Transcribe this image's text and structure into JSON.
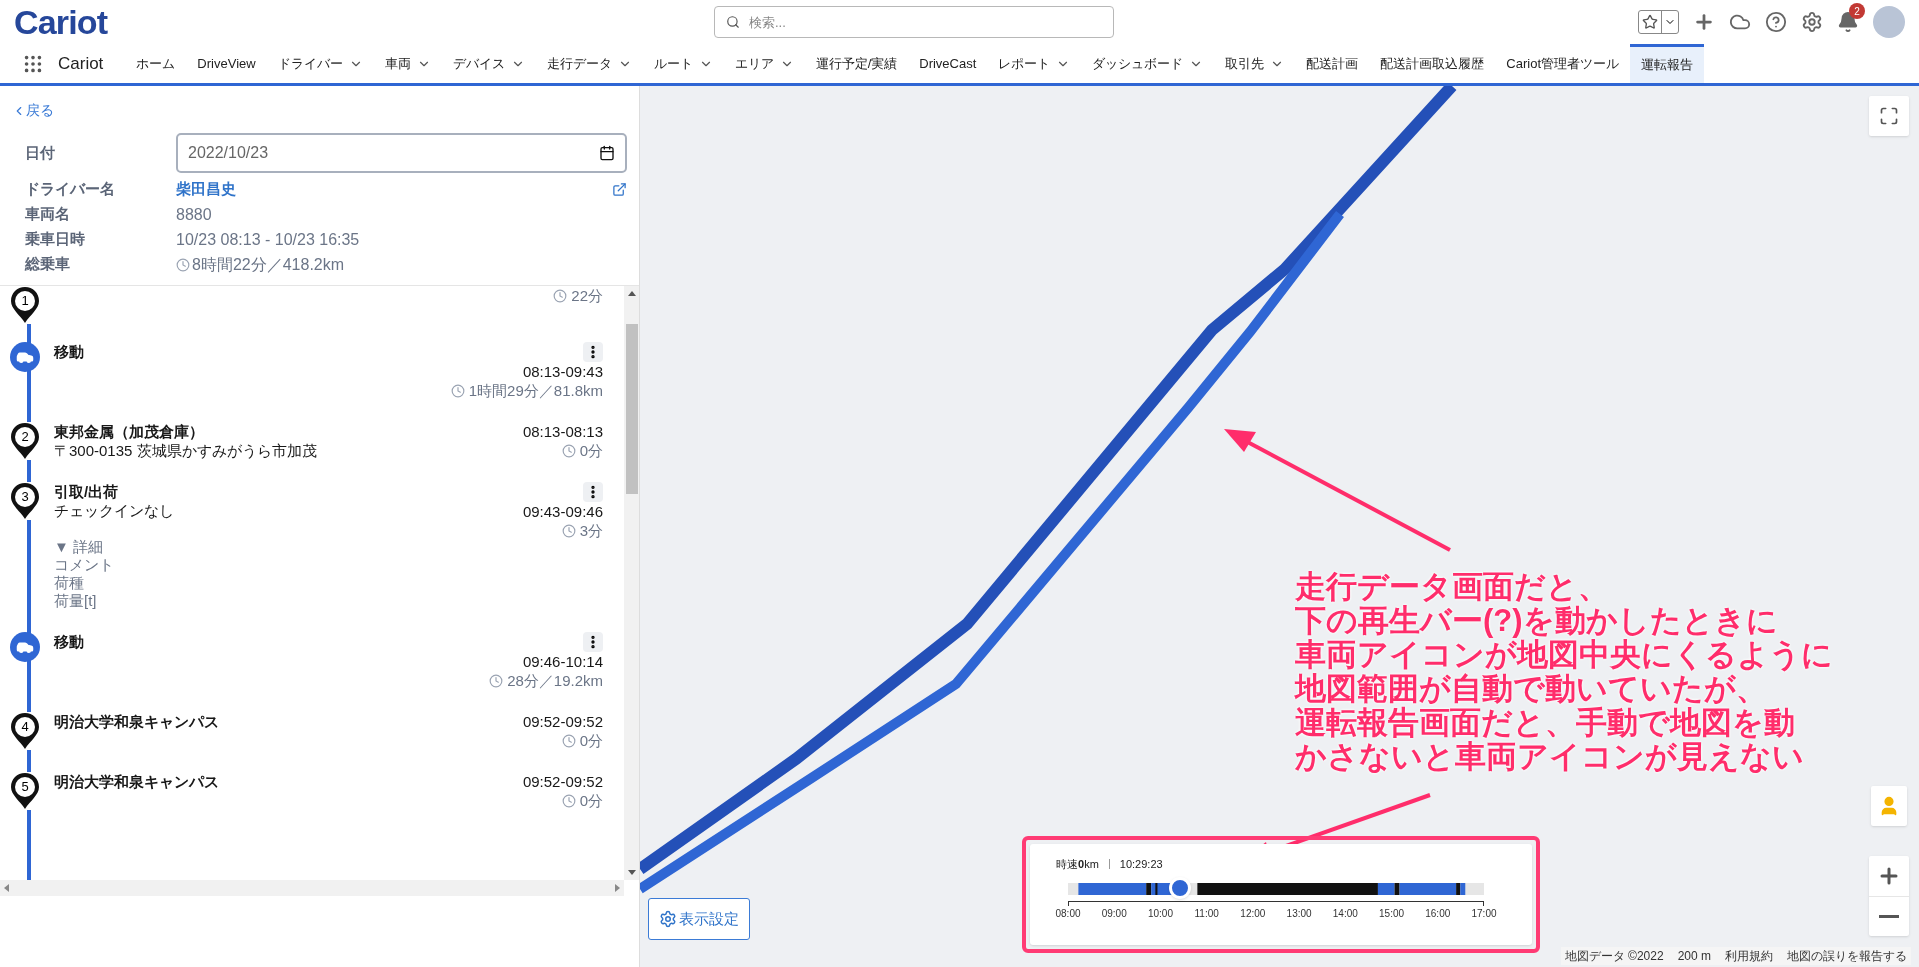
{
  "header": {
    "logo": "Cariot",
    "search": {
      "placeholder": "検索..."
    },
    "notification_count": "2"
  },
  "nav": {
    "app_name": "Cariot",
    "items": [
      {
        "label": "ホーム",
        "has_menu": false,
        "selected": false
      },
      {
        "label": "DriveView",
        "has_menu": false,
        "selected": false
      },
      {
        "label": "ドライバー",
        "has_menu": true,
        "selected": false
      },
      {
        "label": "車両",
        "has_menu": true,
        "selected": false
      },
      {
        "label": "デバイス",
        "has_menu": true,
        "selected": false
      },
      {
        "label": "走行データ",
        "has_menu": true,
        "selected": false
      },
      {
        "label": "ルート",
        "has_menu": true,
        "selected": false
      },
      {
        "label": "エリア",
        "has_menu": true,
        "selected": false
      },
      {
        "label": "運行予定/実績",
        "has_menu": false,
        "selected": false
      },
      {
        "label": "DriveCast",
        "has_menu": false,
        "selected": false
      },
      {
        "label": "レポート",
        "has_menu": true,
        "selected": false
      },
      {
        "label": "ダッシュボード",
        "has_menu": true,
        "selected": false
      },
      {
        "label": "取引先",
        "has_menu": true,
        "selected": false
      },
      {
        "label": "配送計画",
        "has_menu": false,
        "selected": false
      },
      {
        "label": "配送計画取込履歴",
        "has_menu": false,
        "selected": false
      },
      {
        "label": "Cariot管理者ツール",
        "has_menu": false,
        "selected": false
      },
      {
        "label": "運転報告",
        "has_menu": false,
        "selected": true
      }
    ]
  },
  "detail": {
    "back": "戻る",
    "fields": [
      {
        "label": "日付",
        "kind": "date",
        "value": "2022/10/23"
      },
      {
        "label": "ドライバー名",
        "kind": "link",
        "value": "柴田昌史"
      },
      {
        "label": "車両名",
        "kind": "text",
        "value": "8880"
      },
      {
        "label": "乗車日時",
        "kind": "text",
        "value": "10/23 08:13 - 10/23 16:35"
      },
      {
        "label": "総乗車",
        "kind": "duration",
        "value": "8時間22分／418.2km"
      }
    ]
  },
  "timeline": [
    {
      "kind": "stop",
      "number": "1",
      "duration": "22分",
      "menu": false
    },
    {
      "kind": "move",
      "title": "移動",
      "time": "08:13-09:43",
      "duration": "1時間29分／81.8km",
      "menu": true
    },
    {
      "kind": "stop",
      "number": "2",
      "title": "東邦金属（加茂倉庫）",
      "subtitle": "〒300-0135 茨城県かすみがうら市加茂",
      "time": "08:13-08:13",
      "duration": "0分",
      "menu": false
    },
    {
      "kind": "stop",
      "number": "3",
      "title": "引取/出荷",
      "subtitle": "チェックインなし",
      "time": "09:43-09:46",
      "duration": "3分",
      "menu": true,
      "details": {
        "toggle": "▼ 詳細",
        "expanded": true,
        "lines": [
          "コメント",
          "荷種",
          "荷量[t]"
        ]
      }
    },
    {
      "kind": "move",
      "title": "移動",
      "time": "09:46-10:14",
      "duration": "28分／19.2km",
      "menu": true
    },
    {
      "kind": "stop",
      "number": "4",
      "title": "明治大学和泉キャンパス",
      "time": "09:52-09:52",
      "duration": "0分",
      "menu": false
    },
    {
      "kind": "stop",
      "number": "5",
      "title": "明治大学和泉キャンパス",
      "time": "09:52-09:52",
      "duration": "0分",
      "menu": false
    }
  ],
  "map": {
    "display_settings": "表示設定",
    "playback": {
      "speed": "時速**0**km",
      "time": "10:29:23",
      "level": 0.27,
      "ticks": [
        "08:00",
        "09:00",
        "10:00",
        "11:00",
        "12:00",
        "13:00",
        "14:00",
        "15:00",
        "16:00",
        "17:00"
      ]
    },
    "attribution": [
      "地図データ ©2022",
      "200 m",
      "利用規約",
      "地図の誤りを報告する"
    ],
    "annotation": {
      "lines": [
        "走行データ画面だと、",
        "下の再生バー(?)を動かしたときに",
        "車両アイコンが地図中央にくるように",
        "地図範囲が自動で動いていたが、",
        "運転報告画面だと、手動で地図を動",
        "かさないと車両アイコンが見えない"
      ]
    }
  }
}
